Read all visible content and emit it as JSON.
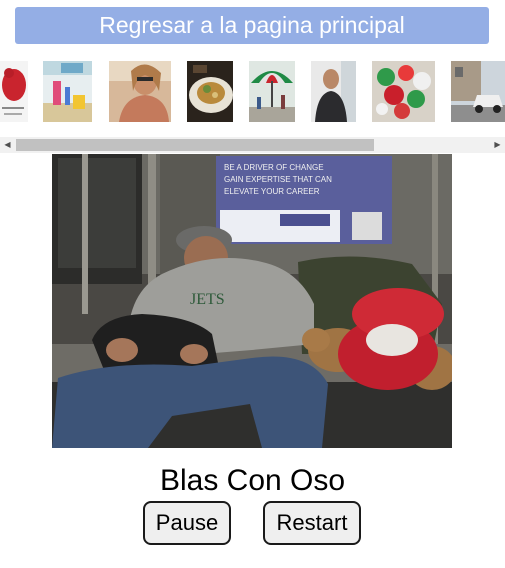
{
  "nav": {
    "home_label": "Regresar a la pagina principal",
    "button_color": "#94aee5"
  },
  "gallery": {
    "thumbnails": [
      {
        "name": "red-bear-thumb"
      },
      {
        "name": "hallway-thumb"
      },
      {
        "name": "woman-sunglasses-thumb"
      },
      {
        "name": "food-plate-thumb"
      },
      {
        "name": "umbrella-plaza-thumb"
      },
      {
        "name": "man-portrait-thumb"
      },
      {
        "name": "decorations-thumb"
      },
      {
        "name": "car-street-thumb"
      }
    ]
  },
  "scrollbar": {
    "left_arrow": "◀",
    "right_arrow": "▶"
  },
  "main_photo": {
    "poster_line1": "BE A DRIVER OF CHANGE",
    "poster_line2": "GAIN EXPERTISE THAT CAN",
    "poster_line3": "ELEVATE YOUR CAREER"
  },
  "caption": "Blas Con Oso",
  "controls": {
    "pause_label": "Pause",
    "restart_label": "Restart"
  }
}
